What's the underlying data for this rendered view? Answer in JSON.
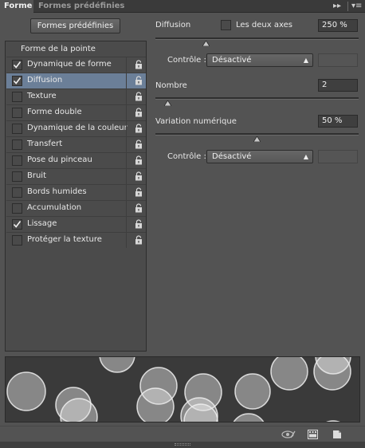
{
  "tabs": [
    {
      "label": "Forme",
      "active": true
    },
    {
      "label": "Formes prédéfinies",
      "active": false
    }
  ],
  "toolbar_icons": [
    "expand-icon",
    "panel-menu-icon"
  ],
  "preset_button": "Formes prédéfinies",
  "sidebar": {
    "header": "Forme de la pointe",
    "items": [
      {
        "label": "Dynamique de forme",
        "checked": true,
        "selected": false,
        "lock": true
      },
      {
        "label": "Diffusion",
        "checked": true,
        "selected": true,
        "lock": true
      },
      {
        "label": "Texture",
        "checked": false,
        "selected": false,
        "lock": true
      },
      {
        "label": "Forme double",
        "checked": false,
        "selected": false,
        "lock": true
      },
      {
        "label": "Dynamique de la couleur",
        "checked": false,
        "selected": false,
        "lock": true
      },
      {
        "label": "Transfert",
        "checked": false,
        "selected": false,
        "lock": true
      },
      {
        "label": "Pose du pinceau",
        "checked": false,
        "selected": false,
        "lock": true
      },
      {
        "label": "Bruit",
        "checked": false,
        "selected": false,
        "lock": true
      },
      {
        "label": "Bords humides",
        "checked": false,
        "selected": false,
        "lock": true
      },
      {
        "label": "Accumulation",
        "checked": false,
        "selected": false,
        "lock": true
      },
      {
        "label": "Lissage",
        "checked": true,
        "selected": false,
        "lock": true
      },
      {
        "label": "Protéger la texture",
        "checked": false,
        "selected": false,
        "lock": true
      }
    ]
  },
  "settings": {
    "diffusion": {
      "label": "Diffusion",
      "both_axes_label": "Les deux axes",
      "both_axes_checked": false,
      "value": "250 %",
      "slider_fraction": 0.25
    },
    "controle1": {
      "label": "Contrôle :",
      "value": "Désactivé"
    },
    "nombre": {
      "label": "Nombre",
      "value": "2",
      "slider_fraction": 0.06
    },
    "variation": {
      "label": "Variation numérique",
      "value": "50 %",
      "slider_fraction": 0.5
    },
    "controle2": {
      "label": "Contrôle :",
      "value": "Désactivé"
    }
  },
  "colors": {
    "panel_bg": "#535353",
    "selected_row": "#6b7f98",
    "preview_bg": "#3a3a3a"
  },
  "bottom_icons": [
    "toggle-brush-preview-icon",
    "brush-grid-icon",
    "new-brush-icon"
  ]
}
